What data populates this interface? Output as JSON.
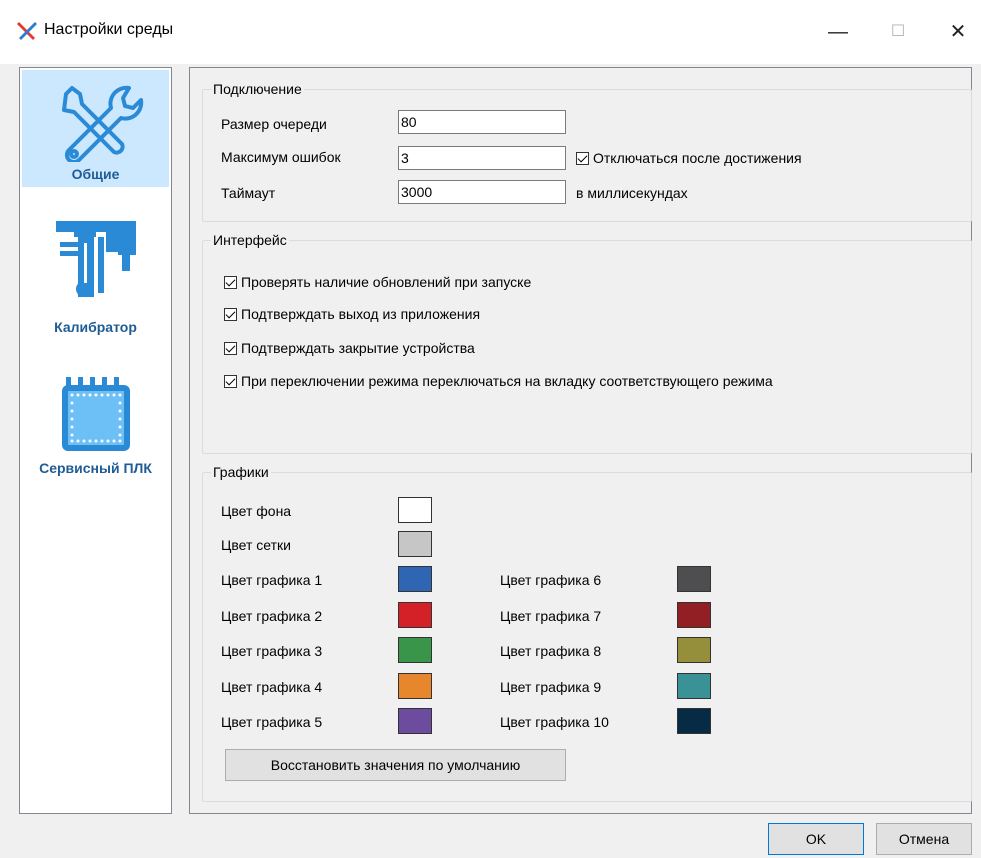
{
  "window": {
    "title": "Настройки среды",
    "minimize": "—",
    "maximize": "☐",
    "close": "✕"
  },
  "sidebar": {
    "items": [
      {
        "label": "Общие",
        "icon": "tools-icon",
        "selected": true
      },
      {
        "label": "Калибратор",
        "icon": "caliper-icon",
        "selected": false
      },
      {
        "label": "Сервисный ПЛК",
        "icon": "chip-icon",
        "selected": false
      }
    ]
  },
  "connection": {
    "title": "Подключение",
    "queue_size_label": "Размер очереди",
    "queue_size_value": "80",
    "max_errors_label": "Максимум ошибок",
    "max_errors_value": "3",
    "disconnect_label": "Отключаться после достижения",
    "disconnect_checked": true,
    "timeout_label": "Таймаут",
    "timeout_value": "3000",
    "timeout_unit": "в миллисекундах"
  },
  "interface": {
    "title": "Интерфейс",
    "options": [
      {
        "label": "Проверять наличие обновлений при запуске",
        "checked": true
      },
      {
        "label": "Подтверждать выход из приложения",
        "checked": true
      },
      {
        "label": "Подтверждать закрытие устройства",
        "checked": true
      },
      {
        "label": "При переключении режима переключаться на вкладку соответствующего режима",
        "checked": true
      }
    ]
  },
  "graphics": {
    "title": "Графики",
    "background_label": "Цвет фона",
    "background_color": "#ffffff",
    "grid_label": "Цвет сетки",
    "grid_color": "#c6c6c6",
    "series": [
      {
        "label": "Цвет графика 1",
        "color": "#2e66b4"
      },
      {
        "label": "Цвет графика 2",
        "color": "#d42127"
      },
      {
        "label": "Цвет графика 3",
        "color": "#39954a"
      },
      {
        "label": "Цвет графика 4",
        "color": "#e6862d"
      },
      {
        "label": "Цвет графика 5",
        "color": "#6d4b9e"
      },
      {
        "label": "Цвет графика 6",
        "color": "#4e4e50"
      },
      {
        "label": "Цвет графика 7",
        "color": "#921f24"
      },
      {
        "label": "Цвет графика 8",
        "color": "#958f3b"
      },
      {
        "label": "Цвет графика 9",
        "color": "#3a9296"
      },
      {
        "label": "Цвет графика 10",
        "color": "#072b44"
      }
    ],
    "reset_label": "Восстановить значения по умолчанию"
  },
  "footer": {
    "ok_label": "OK",
    "cancel_label": "Отмена"
  }
}
